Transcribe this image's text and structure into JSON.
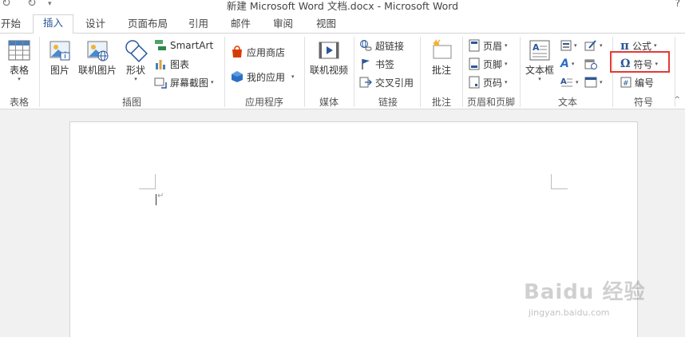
{
  "window": {
    "title": "新建 Microsoft Word 文档.docx - Microsoft Word",
    "help": "?"
  },
  "tabs": [
    "开始",
    "插入",
    "设计",
    "页面布局",
    "引用",
    "邮件",
    "审阅",
    "视图"
  ],
  "active_tab": "插入",
  "ribbon": {
    "table": {
      "button": "表格",
      "group": "表格"
    },
    "illustrations": {
      "picture": "图片",
      "online_picture": "联机图片",
      "shapes": "形状",
      "smartart": "SmartArt",
      "chart": "图表",
      "screenshot": "屏幕截图",
      "group": "插图"
    },
    "apps": {
      "store": "应用商店",
      "my_apps": "我的应用",
      "group": "应用程序"
    },
    "media": {
      "online_video": "联机视频",
      "group": "媒体"
    },
    "links": {
      "hyperlink": "超链接",
      "bookmark": "书签",
      "cross_reference": "交叉引用",
      "group": "链接"
    },
    "comments": {
      "comment": "批注",
      "group": "批注"
    },
    "header_footer": {
      "header": "页眉",
      "footer": "页脚",
      "page_number": "页码",
      "group": "页眉和页脚"
    },
    "text": {
      "textbox": "文本框",
      "group": "文本"
    },
    "symbols": {
      "equation": "公式",
      "symbol": "符号",
      "number": "编号",
      "group": "符号",
      "pi_glyph": "π",
      "omega_glyph": "Ω"
    }
  },
  "watermark": {
    "brand": "Baidu 经验",
    "url": "jingyan.baidu.com"
  },
  "colors": {
    "accent": "#2b579a",
    "highlight": "#e53935"
  }
}
